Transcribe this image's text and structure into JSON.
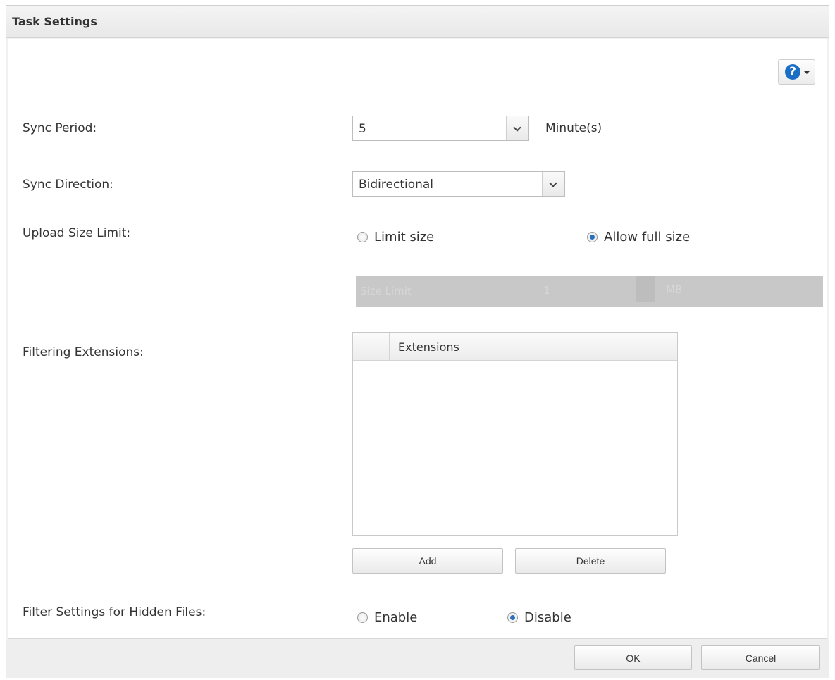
{
  "dialog": {
    "title": "Task Settings",
    "help_icon": "help-icon"
  },
  "sync_period": {
    "label": "Sync Period:",
    "value": "5",
    "unit": "Minute(s)"
  },
  "sync_direction": {
    "label": "Sync Direction:",
    "value": "Bidirectional"
  },
  "upload_size_limit": {
    "label": "Upload Size Limit:",
    "options": [
      {
        "label": "Limit size",
        "selected": false
      },
      {
        "label": "Allow full size",
        "selected": true
      }
    ],
    "size_limit_label": "Size Limit",
    "size_limit_value": "1",
    "size_limit_unit": "MB",
    "disabled": true
  },
  "filtering_extensions": {
    "label": "Filtering Extensions:",
    "column_header": "Extensions",
    "rows": [],
    "add_label": "Add",
    "delete_label": "Delete"
  },
  "hidden_files": {
    "label": "Filter Settings for Hidden Files:",
    "options": [
      {
        "label": "Enable",
        "selected": false
      },
      {
        "label": "Disable",
        "selected": true
      }
    ]
  },
  "footer": {
    "ok_label": "OK",
    "cancel_label": "Cancel"
  }
}
